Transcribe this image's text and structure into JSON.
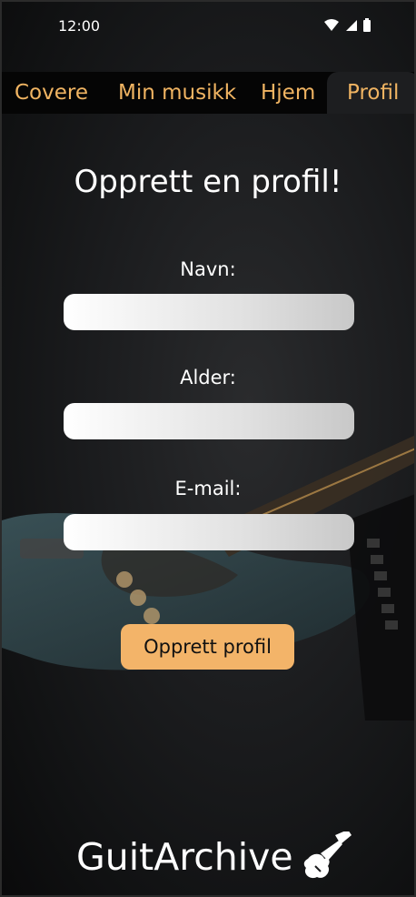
{
  "statusbar": {
    "time": "12:00"
  },
  "tabs": [
    {
      "label": "Covere"
    },
    {
      "label": "Min musikk"
    },
    {
      "label": "Hjem"
    },
    {
      "label": "Profil",
      "active": true
    }
  ],
  "form": {
    "title": "Opprett en profil!",
    "fields": [
      {
        "label": "Navn:",
        "value": ""
      },
      {
        "label": "Alder:",
        "value": ""
      },
      {
        "label": "E-mail:",
        "value": ""
      }
    ],
    "submit_label": "Opprett profil"
  },
  "brand": {
    "name": "GuitArchive",
    "icon": "guitar-icon"
  },
  "colors": {
    "accent": "#f3b469",
    "tab_text": "#f0b462",
    "background": "#1b1c1e"
  }
}
